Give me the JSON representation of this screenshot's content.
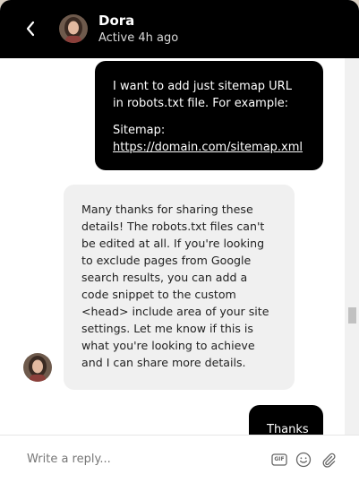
{
  "header": {
    "name": "Dora",
    "status": "Active 4h ago",
    "back_icon": "chevron-left-icon"
  },
  "messages": [
    {
      "direction": "outgoing",
      "line1": "I want to add just sitemap URL in robots.txt file. For example:",
      "sitemap_label": "Sitemap:",
      "sitemap_link": "https://domain.com/sitemap.xml"
    },
    {
      "direction": "incoming",
      "text": "Many thanks for sharing these details! The robots.txt files can't be edited at all. If you're looking to exclude pages from Google search results, you can add a code snippet to the custom <head> include area of your site settings. Let me know if this is what you're looking to achieve and I can share more details."
    },
    {
      "direction": "outgoing",
      "text": "Thanks"
    }
  ],
  "composer": {
    "placeholder": "Write a reply...",
    "gif_label": "GIF",
    "icons": [
      "gif-icon",
      "emoji-icon",
      "attachment-icon"
    ]
  },
  "colors": {
    "header_bg": "#000000",
    "outgoing_bubble": "#000000",
    "incoming_bubble": "#f0f0f0",
    "background": "#ffffff"
  }
}
